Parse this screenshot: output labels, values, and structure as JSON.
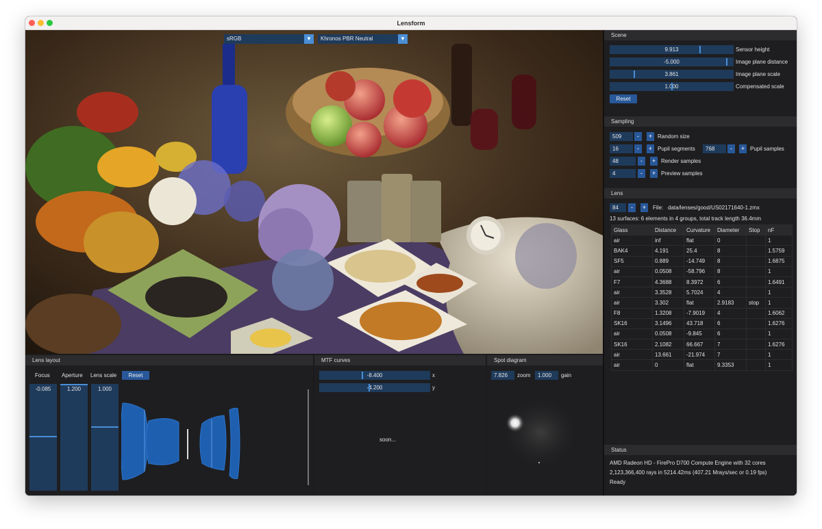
{
  "app": {
    "title": "Lensform"
  },
  "viewport": {
    "colorspace": "sRGB",
    "tonemap": "Khronos PBR Neutral"
  },
  "scene": {
    "header": "Scene",
    "fields": [
      {
        "value": "9.913",
        "label": "Sensor height"
      },
      {
        "value": "-5.000",
        "label": "Image plane distance"
      },
      {
        "value": "3.861",
        "label": "Image plane scale"
      },
      {
        "value": "1.000",
        "label": "Compensated scale"
      }
    ],
    "reset": "Reset"
  },
  "sampling": {
    "header": "Sampling",
    "random_size": {
      "value": "509",
      "label": "Random size"
    },
    "pupil_segments": {
      "value": "16",
      "label": "Pupil segments"
    },
    "pupil_samples": {
      "value": "768",
      "label": "Pupil samples"
    },
    "render_samples": {
      "value": "48",
      "label": "Render samples"
    },
    "preview_samples": {
      "value": "4",
      "label": "Preview samples"
    },
    "minus": "-",
    "plus": "+"
  },
  "lens": {
    "header": "Lens",
    "index": "84",
    "file_label": "File:",
    "file_path": "data/lenses/good/US02171640-1.zmx",
    "summary": "13 surfaces: 6 elements in 4 groups, total track length 36.4mm",
    "columns": [
      "Glass",
      "Distance",
      "Curvature",
      "Diameter",
      "Stop",
      "nF"
    ],
    "rows": [
      [
        "air",
        "inf",
        "flat",
        "0",
        "",
        "1"
      ],
      [
        "BAK4",
        "4.191",
        "25.4",
        "8",
        "",
        "1.5759"
      ],
      [
        "SF5",
        "0.889",
        "-14.749",
        "8",
        "",
        "1.6875"
      ],
      [
        "air",
        "0.0508",
        "-58.796",
        "8",
        "",
        "1"
      ],
      [
        "F7",
        "4.3688",
        "8.3972",
        "6",
        "",
        "1.6491"
      ],
      [
        "air",
        "3.3528",
        "5.7024",
        "4",
        "",
        "1"
      ],
      [
        "air",
        "3.302",
        "flat",
        "2.9183",
        "stop",
        "1"
      ],
      [
        "F8",
        "1.3208",
        "-7.9019",
        "4",
        "",
        "1.6062"
      ],
      [
        "SK16",
        "3.1496",
        "43.718",
        "6",
        "",
        "1.6276"
      ],
      [
        "air",
        "0.0508",
        "-9.845",
        "6",
        "",
        "1"
      ],
      [
        "SK16",
        "2.1082",
        "66.667",
        "7",
        "",
        "1.6276"
      ],
      [
        "air",
        "13.661",
        "-21.974",
        "7",
        "",
        "1"
      ],
      [
        "air",
        "0",
        "flat",
        "9.3353",
        "",
        "1"
      ]
    ]
  },
  "status": {
    "header": "Status",
    "device": "AMD Radeon HD - FirePro D700 Compute Engine with 32 cores",
    "rays": "2,123,366,400 rays in 5214.42ms   (407.21 Mrays/sec or 0.19 fps)",
    "state": "Ready"
  },
  "lens_layout": {
    "header": "Lens layout",
    "focus_label": "Focus",
    "aperture_label": "Aperture",
    "scale_label": "Lens scale",
    "reset": "Reset",
    "focus_value": "-0.085",
    "aperture_value": "1.200",
    "scale_value": "1.000",
    "focus_level": 0.52,
    "aperture_level": 0.0,
    "scale_level": 0.42
  },
  "mtf": {
    "header": "MTF curves",
    "x_value": "-8.400",
    "x_label": "x",
    "y_value": "-4.200",
    "y_label": "y",
    "placeholder": "soon..."
  },
  "spot": {
    "header": "Spot diagram",
    "zoom_value": "7.826",
    "zoom_label": "zoom",
    "gain_value": "1.000",
    "gain_label": "gain"
  },
  "colors": {
    "accent": "#4a8fd6",
    "field_bg": "#1f3b5c",
    "button_bg": "#28589a",
    "window_bg": "#1b1b1d"
  }
}
